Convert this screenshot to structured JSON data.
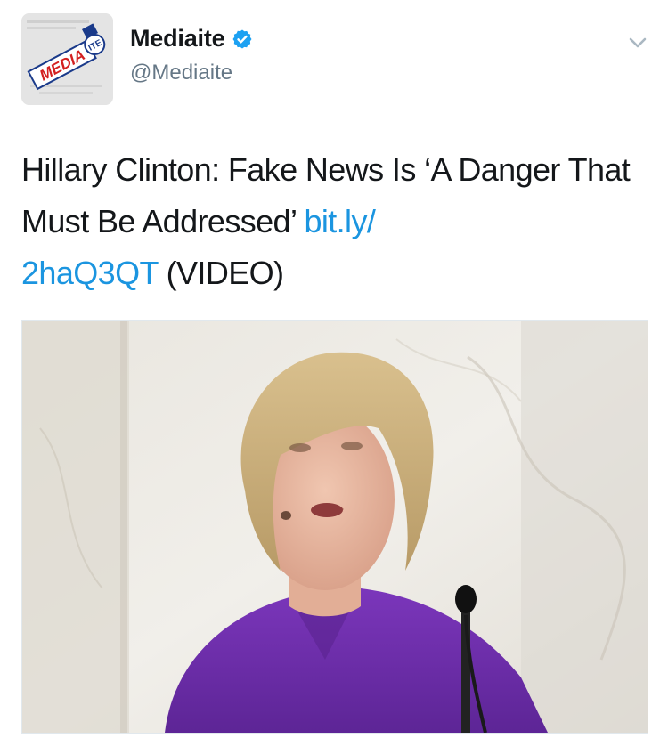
{
  "author": {
    "display_name": "Mediaite",
    "handle": "@Mediaite",
    "verified": true,
    "avatar_logo_text": "MEDIAITE"
  },
  "tweet": {
    "text_plain": "Hillary Clinton: Fake News Is ‘A Danger That Must Be Addressed’ ",
    "link_part1": "bit.ly/",
    "link_part2": "2haQ3QT",
    "suffix": " (VIDEO)"
  },
  "icons": {
    "verified": "verified-badge-icon",
    "menu": "chevron-down-icon"
  },
  "colors": {
    "link": "#1b95e0",
    "text": "#14171a",
    "muted": "#657786",
    "verified": "#1da1f2",
    "suit": "#6a2ba8"
  }
}
